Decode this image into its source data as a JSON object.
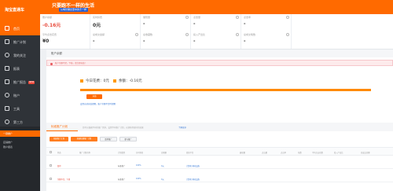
{
  "banner": {
    "title": "只要跑不一样的生活",
    "subtitle": "从每份懈怠里中的不一样"
  },
  "sidebar": {
    "logo": "淘宝直通车",
    "items": [
      {
        "label": "首页",
        "icon": "home-icon"
      },
      {
        "label": "推广计划",
        "icon": "plan-icon"
      },
      {
        "label": "我的关注",
        "icon": "heart-icon"
      },
      {
        "label": "报表",
        "icon": "report-icon"
      },
      {
        "label": "推广报告",
        "icon": "chart-icon",
        "badge": "NEW"
      },
      {
        "label": "账户",
        "icon": "account-icon"
      },
      {
        "label": "工具",
        "icon": "tool-icon"
      },
      {
        "label": "第三方",
        "icon": "plugin-icon"
      }
    ],
    "sub": {
      "active": "一键推广",
      "items": [
        "店铺推广",
        "账户报表"
      ]
    }
  },
  "stats": [
    {
      "label": "账户余额",
      "value": "-0.16元",
      "negative": true
    },
    {
      "label": "实时扣费",
      "value": "0元"
    },
    {
      "label": "展现量",
      "value": "-"
    },
    {
      "label": "点击量",
      "value": "-"
    },
    {
      "label": "点击率",
      "value": "-"
    },
    {
      "label": "平均点击花费",
      "value": "¥0",
      "sub": ""
    },
    {
      "label": "总成交金额",
      "value": "-"
    },
    {
      "label": "总收藏数",
      "value": "-"
    },
    {
      "label": "投入产出比",
      "value": "-"
    },
    {
      "label": "总成交笔数",
      "value": "-"
    }
  ],
  "account": {
    "header": "账户余额",
    "alert": "账户余额不足，下线，请立即充值！",
    "today_cost_label": "今日花费：",
    "today_cost_value": "0元",
    "balance_label": "余额：",
    "balance_value": "-0.16元",
    "recharge_button": "充值",
    "recharge_link": "设置自动充值提醒，账户余额不足时提醒",
    "colors": {
      "accent": "#ff6a00",
      "negative": "#e84c3d"
    }
  },
  "plans": {
    "tab": "标准推广计划",
    "tip": "您可以根据不同的推广需求，设置不同推广计划，以便获得更好的效果",
    "tip_link": "了解更多",
    "buttons": [
      "新建推广计划",
      "新建批量推广计划",
      "暂停推广",
      "参与推广"
    ],
    "columns": [
      "状态",
      "推广计划名称",
      "计划类型",
      "分时折扣",
      "日限额",
      "投放平台",
      "展现量",
      "点击量",
      "点击率",
      "花费",
      "平均点击花费",
      "投入产出比",
      "总成交金额"
    ],
    "rows": [
      {
        "status": "暂停",
        "name": "",
        "type": "标准推广",
        "discount": "100%",
        "limit": "0元",
        "platform": "计算机 移动设备"
      },
      {
        "status": "余额不足，下线",
        "name": "",
        "type": "标准推广",
        "discount": "100%",
        "limit": "0元",
        "platform": "计算机 移动设备"
      }
    ]
  }
}
